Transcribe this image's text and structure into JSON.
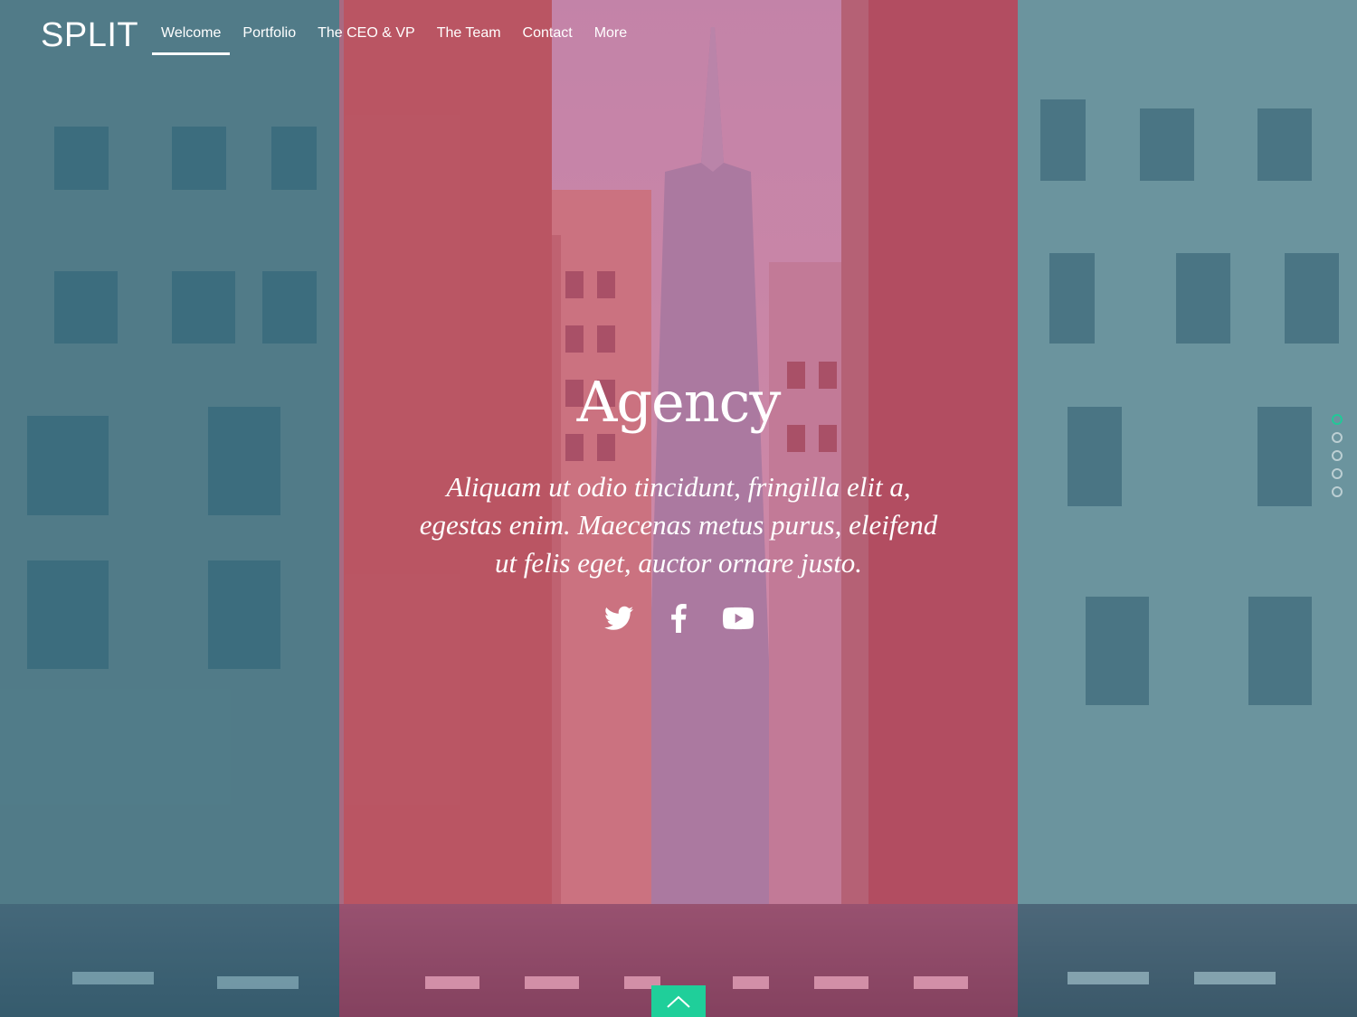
{
  "brand": {
    "logo_text": "SPLIT"
  },
  "nav": {
    "items": [
      {
        "label": "Welcome",
        "active": true
      },
      {
        "label": "Portfolio",
        "active": false
      },
      {
        "label": "The CEO & VP",
        "active": false
      },
      {
        "label": "The Team",
        "active": false
      },
      {
        "label": "Contact",
        "active": false
      },
      {
        "label": "More",
        "active": false
      }
    ]
  },
  "hero": {
    "title": "Agency",
    "text": "Aliquam ut odio tincidunt, fringilla elit a, egestas enim. Maecenas metus purus, eleifend ut felis eget, auctor ornare justo."
  },
  "socials": [
    {
      "icon": "twitter-icon"
    },
    {
      "icon": "facebook-icon"
    },
    {
      "icon": "youtube-icon"
    }
  ],
  "section_dots": {
    "count": 5,
    "active_index": 0
  },
  "scroll_up": {
    "icon": "chevron-up-icon"
  },
  "colors": {
    "accent": "#1fcf9a",
    "overlay_side": "#236e82",
    "overlay_center": "#d23c6e"
  }
}
